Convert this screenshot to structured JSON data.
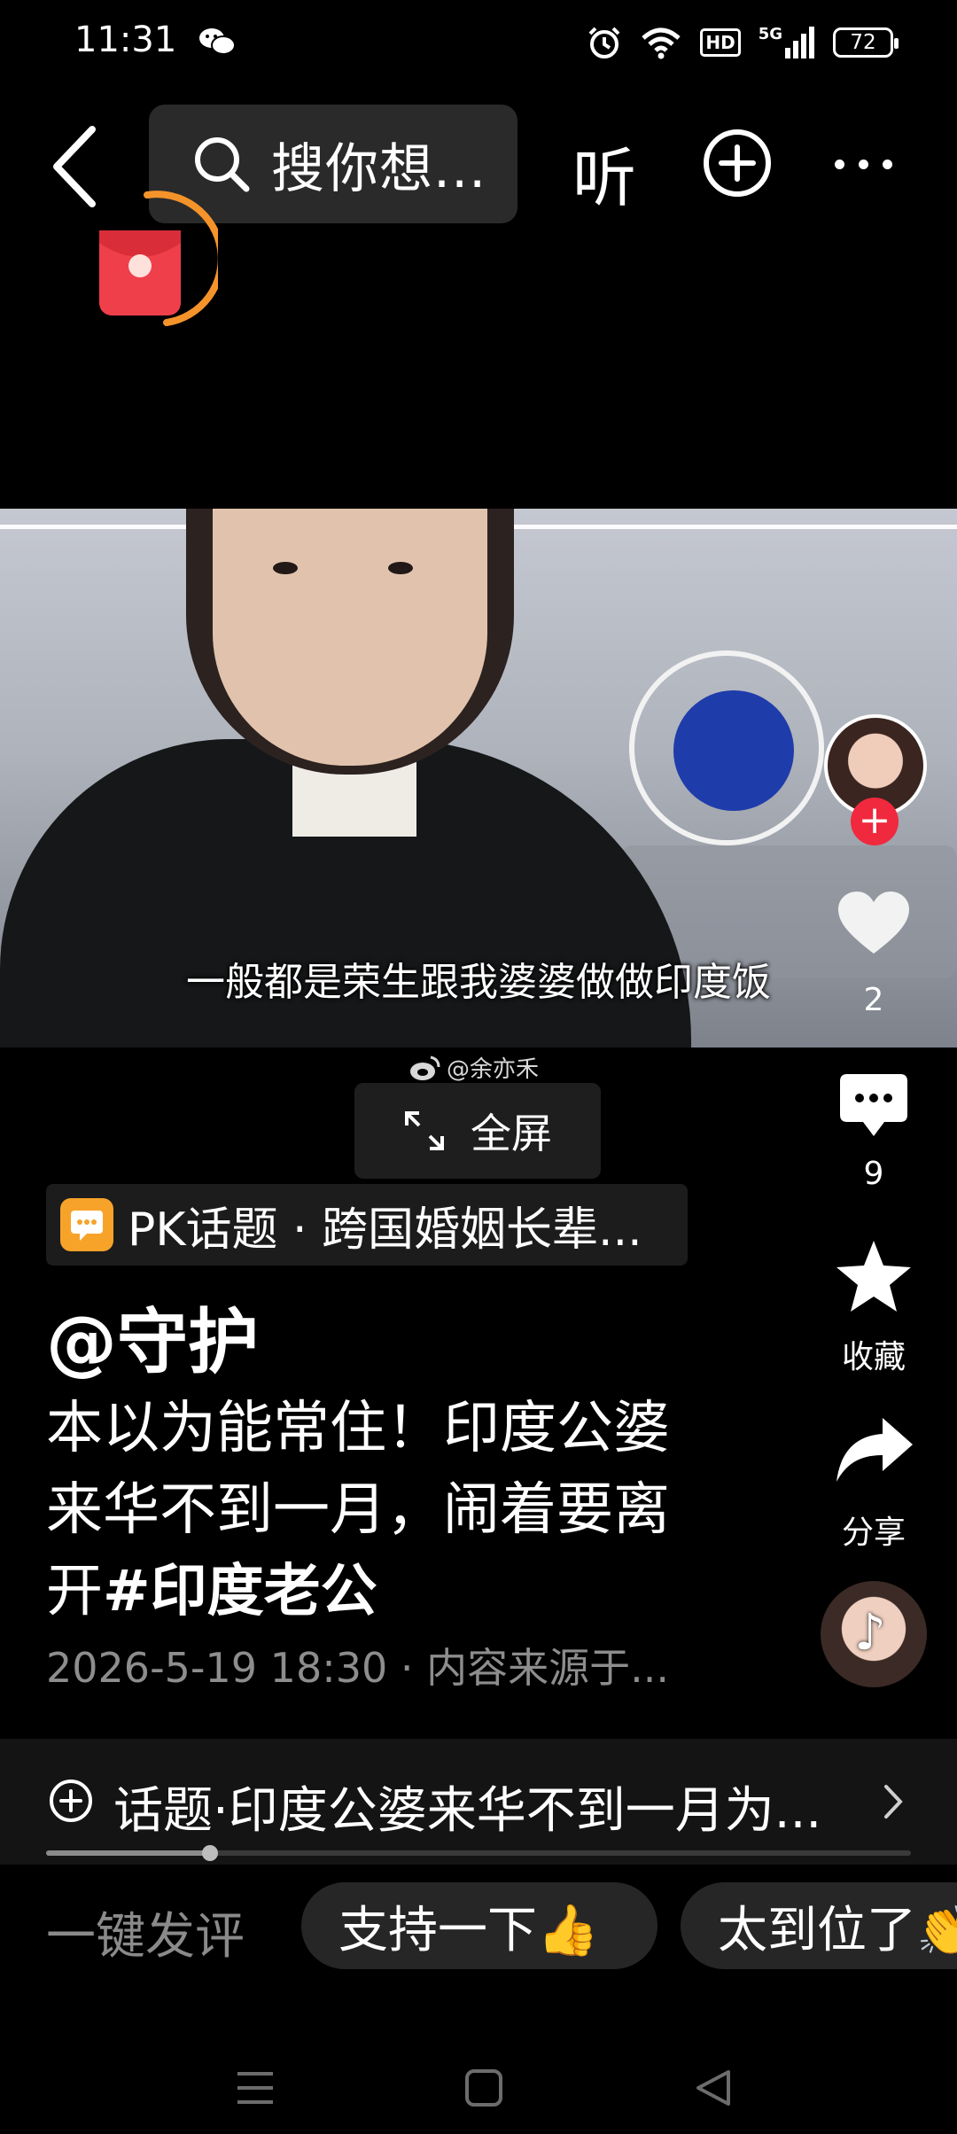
{
  "status_bar": {
    "time": "11:31",
    "network": "5G",
    "hd": "HD",
    "battery": "72",
    "icons": [
      "wechat-icon",
      "alarm-icon",
      "wifi-icon",
      "hd-icon",
      "signal-icon",
      "battery-icon"
    ]
  },
  "top_bar": {
    "search_placeholder": "搜你想...",
    "listen_label": "听",
    "icons": [
      "back-arrow-icon",
      "search-icon",
      "add-circle-icon",
      "more-dots-icon"
    ]
  },
  "video": {
    "subtitle": "一般都是荣生跟我婆婆做做印度饭",
    "watermark": "@余亦禾",
    "fullscreen_label": "全屏"
  },
  "right_rail": {
    "like_count": "2",
    "comment_count": "9",
    "favorite_label": "收藏",
    "share_label": "分享"
  },
  "post": {
    "pk_topic": "PK话题 · 跨国婚姻长辈...",
    "author": "@守护",
    "caption_line1": "本以为能常住！印度公婆",
    "caption_line2": "来华不到一月，闹着要离",
    "caption_line3_prefix": "开",
    "hashtag": "#印度老公",
    "meta": "2026-5-19 18:30 · 内容来源于..."
  },
  "topic_bar": {
    "label": "话题·印度公婆来华不到一月为..."
  },
  "playback": {
    "progress": 0.19
  },
  "quick_comments": {
    "label": "一键发评",
    "options": [
      "支持一下👍",
      "太到位了👏"
    ]
  },
  "colors": {
    "background": "#000000",
    "accent_red": "#f0293e",
    "redpack_orange": "#f5932b",
    "chip_orange": "#f7a32a"
  }
}
